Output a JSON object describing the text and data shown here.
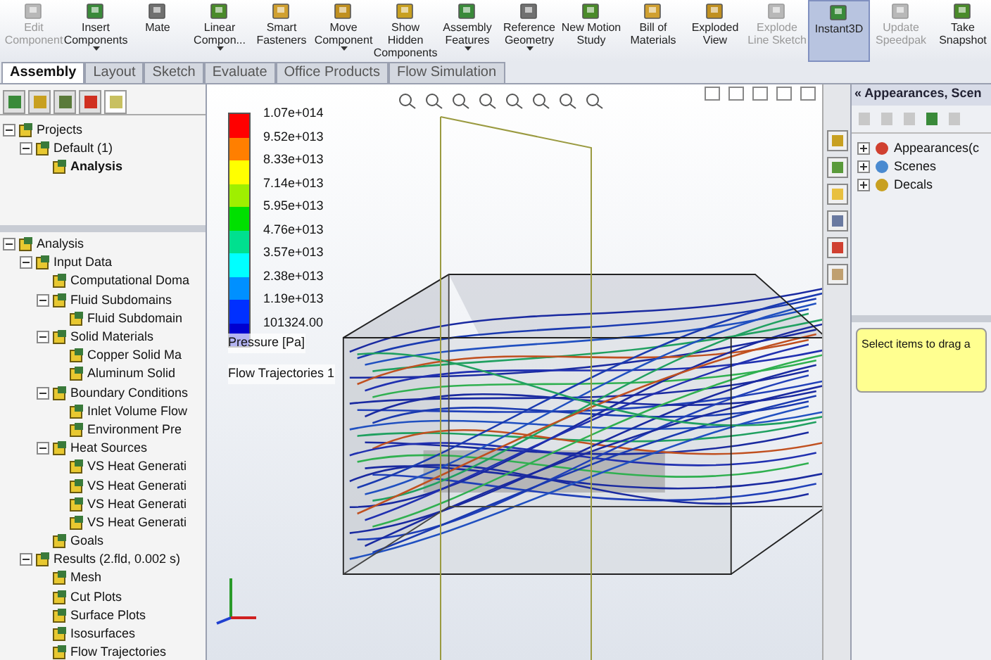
{
  "toolbar": {
    "buttons": [
      {
        "label": "Edit Component",
        "disabled": true,
        "dropdown": false,
        "selected": false
      },
      {
        "label": "Insert Components",
        "disabled": false,
        "dropdown": true,
        "selected": false
      },
      {
        "label": "Mate",
        "disabled": false,
        "dropdown": false,
        "selected": false
      },
      {
        "label": "Linear Compon...",
        "disabled": false,
        "dropdown": true,
        "selected": false
      },
      {
        "label": "Smart Fasteners",
        "disabled": false,
        "dropdown": false,
        "selected": false
      },
      {
        "label": "Move Component",
        "disabled": false,
        "dropdown": true,
        "selected": false
      },
      {
        "label": "Show Hidden Components",
        "disabled": false,
        "dropdown": false,
        "selected": false
      },
      {
        "label": "Assembly Features",
        "disabled": false,
        "dropdown": true,
        "selected": false
      },
      {
        "label": "Reference Geometry",
        "disabled": false,
        "dropdown": true,
        "selected": false
      },
      {
        "label": "New Motion Study",
        "disabled": false,
        "dropdown": false,
        "selected": false
      },
      {
        "label": "Bill of Materials",
        "disabled": false,
        "dropdown": false,
        "selected": false
      },
      {
        "label": "Exploded View",
        "disabled": false,
        "dropdown": false,
        "selected": false
      },
      {
        "label": "Explode Line Sketch",
        "disabled": true,
        "dropdown": false,
        "selected": false
      },
      {
        "label": "Instant3D",
        "disabled": false,
        "dropdown": false,
        "selected": true
      },
      {
        "label": "Update Speedpak",
        "disabled": true,
        "dropdown": false,
        "selected": false
      },
      {
        "label": "Take Snapshot",
        "disabled": false,
        "dropdown": false,
        "selected": false
      }
    ]
  },
  "tabs": [
    {
      "label": "Assembly",
      "selected": true
    },
    {
      "label": "Layout",
      "selected": false
    },
    {
      "label": "Sketch",
      "selected": false
    },
    {
      "label": "Evaluate",
      "selected": false
    },
    {
      "label": "Office Products",
      "selected": false
    },
    {
      "label": "Flow Simulation",
      "selected": false
    }
  ],
  "projects_tree": [
    {
      "label": "Projects",
      "active": false,
      "expanded": true,
      "children": [
        {
          "label": "Default (1)",
          "active": false,
          "expanded": true,
          "children": [
            {
              "label": "Analysis",
              "active": true
            }
          ]
        }
      ]
    }
  ],
  "analysis_tree": [
    {
      "label": "Analysis",
      "expanded": true,
      "children": [
        {
          "label": "Input Data",
          "expanded": true,
          "children": [
            {
              "label": "Computational Doma"
            },
            {
              "label": "Fluid Subdomains",
              "expanded": true,
              "children": [
                {
                  "label": "Fluid Subdomain"
                }
              ]
            },
            {
              "label": "Solid Materials",
              "expanded": true,
              "children": [
                {
                  "label": "Copper Solid Ma"
                },
                {
                  "label": "Aluminum Solid"
                }
              ]
            },
            {
              "label": "Boundary Conditions",
              "expanded": true,
              "children": [
                {
                  "label": "Inlet Volume Flow"
                },
                {
                  "label": "Environment Pre"
                }
              ]
            },
            {
              "label": "Heat Sources",
              "expanded": true,
              "children": [
                {
                  "label": "VS Heat Generati"
                },
                {
                  "label": "VS Heat Generati"
                },
                {
                  "label": "VS Heat Generati"
                },
                {
                  "label": "VS Heat Generati"
                }
              ]
            },
            {
              "label": "Goals"
            }
          ]
        },
        {
          "label": "Results (2.fld, 0.002 s)",
          "expanded": true,
          "children": [
            {
              "label": "Mesh"
            },
            {
              "label": "Cut Plots"
            },
            {
              "label": "Surface Plots"
            },
            {
              "label": "Isosurfaces"
            },
            {
              "label": "Flow Trajectories"
            }
          ]
        }
      ]
    }
  ],
  "legend": {
    "entries": [
      {
        "label": "1.07e+014",
        "color": "#ff0000"
      },
      {
        "label": "9.52e+013",
        "color": "#ff7f00"
      },
      {
        "label": "8.33e+013",
        "color": "#ffff00"
      },
      {
        "label": "7.14e+013",
        "color": "#9fef00"
      },
      {
        "label": "5.95e+013",
        "color": "#00e000"
      },
      {
        "label": "4.76e+013",
        "color": "#00e08f"
      },
      {
        "label": "3.57e+013",
        "color": "#00ffff"
      },
      {
        "label": "2.38e+013",
        "color": "#0090ff"
      },
      {
        "label": "1.19e+013",
        "color": "#0030ff"
      },
      {
        "label": "101324.00",
        "color": "#0000d0"
      }
    ],
    "title": "Pressure [Pa]",
    "subtitle": "Flow Trajectories 1"
  },
  "right_panel": {
    "title": "« Appearances, Scen",
    "items": [
      {
        "label": "Appearances(c",
        "expanded": false
      },
      {
        "label": "Scenes",
        "expanded": false
      },
      {
        "label": "Decals",
        "expanded": false
      }
    ],
    "message": "Select items to drag a"
  }
}
